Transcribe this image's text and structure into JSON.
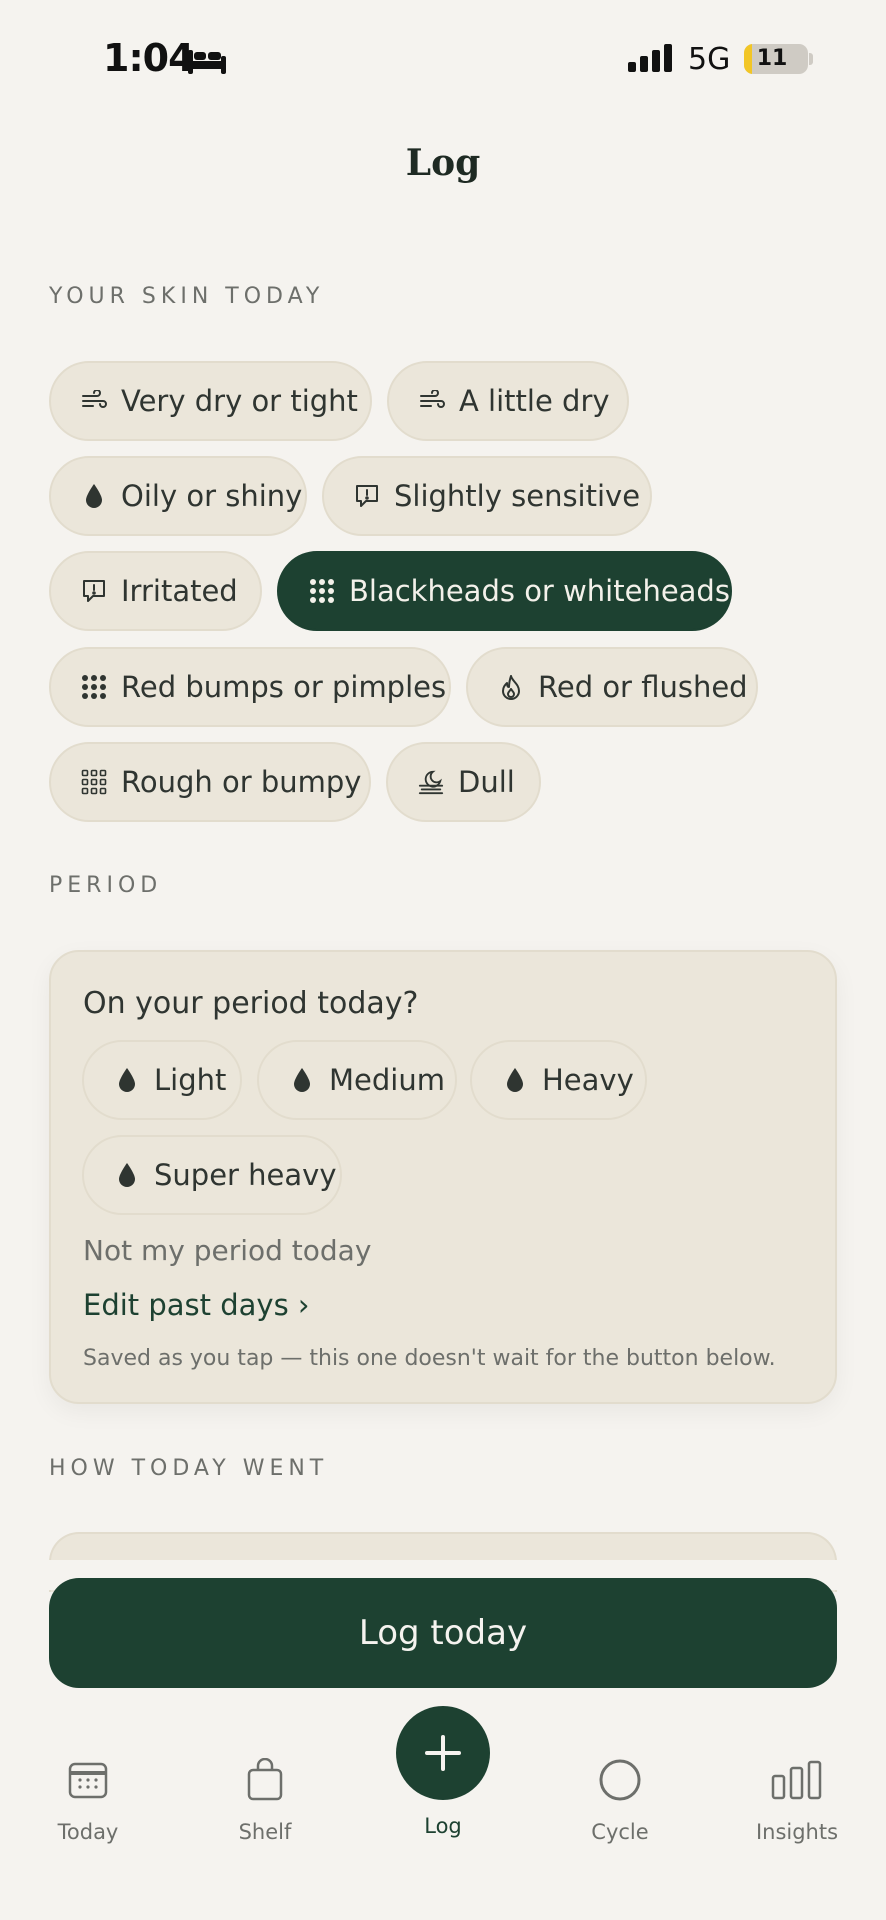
{
  "status_bar": {
    "time": "1:04",
    "network": "5G",
    "battery": "11",
    "battery_level_percent": 11
  },
  "title": "Log",
  "skin_section": {
    "label": "YOUR SKIN TODAY",
    "options": [
      {
        "label": "Very dry or tight",
        "icon": "wind-icon",
        "selected": false
      },
      {
        "label": "A little dry",
        "icon": "wind-icon",
        "selected": false
      },
      {
        "label": "Oily or shiny",
        "icon": "drop-icon",
        "selected": false
      },
      {
        "label": "Slightly sensitive",
        "icon": "alert-bubble-icon",
        "selected": false
      },
      {
        "label": "Irritated",
        "icon": "alert-bubble-icon",
        "selected": false
      },
      {
        "label": "Blackheads or whiteheads",
        "icon": "dots-grid-icon",
        "selected": true
      },
      {
        "label": "Red bumps or pimples",
        "icon": "dots-grid-icon",
        "selected": false
      },
      {
        "label": "Red or flushed",
        "icon": "flame-icon",
        "selected": false
      },
      {
        "label": "Rough or bumpy",
        "icon": "outline-dots-grid-icon",
        "selected": false
      },
      {
        "label": "Dull",
        "icon": "haze-moon-icon",
        "selected": false
      }
    ]
  },
  "period_section": {
    "label": "PERIOD",
    "question": "On your period today?",
    "options": [
      {
        "label": "Light",
        "icon": "drop-icon"
      },
      {
        "label": "Medium",
        "icon": "drop-icon"
      },
      {
        "label": "Heavy",
        "icon": "drop-icon"
      },
      {
        "label": "Super heavy",
        "icon": "drop-icon"
      }
    ],
    "not_period": "Not my period today",
    "edit_past": "Edit past days ›",
    "saved_note": "Saved as you tap — this one doesn't wait for the button below."
  },
  "how_today_section": {
    "label": "HOW TODAY WENT"
  },
  "log_button": "Log today",
  "tabs": [
    {
      "label": "Today",
      "icon": "calendar-icon",
      "active": false
    },
    {
      "label": "Shelf",
      "icon": "bag-icon",
      "active": false
    },
    {
      "label": "Log",
      "icon": "plus-icon",
      "active": true
    },
    {
      "label": "Cycle",
      "icon": "circle-icon",
      "active": false
    },
    {
      "label": "Insights",
      "icon": "bar-chart-icon",
      "active": false
    }
  ],
  "colors": {
    "accent": "#1d4131",
    "background": "#f5f3ef",
    "chip": "#ebe6da",
    "battery": "#f2c626"
  }
}
